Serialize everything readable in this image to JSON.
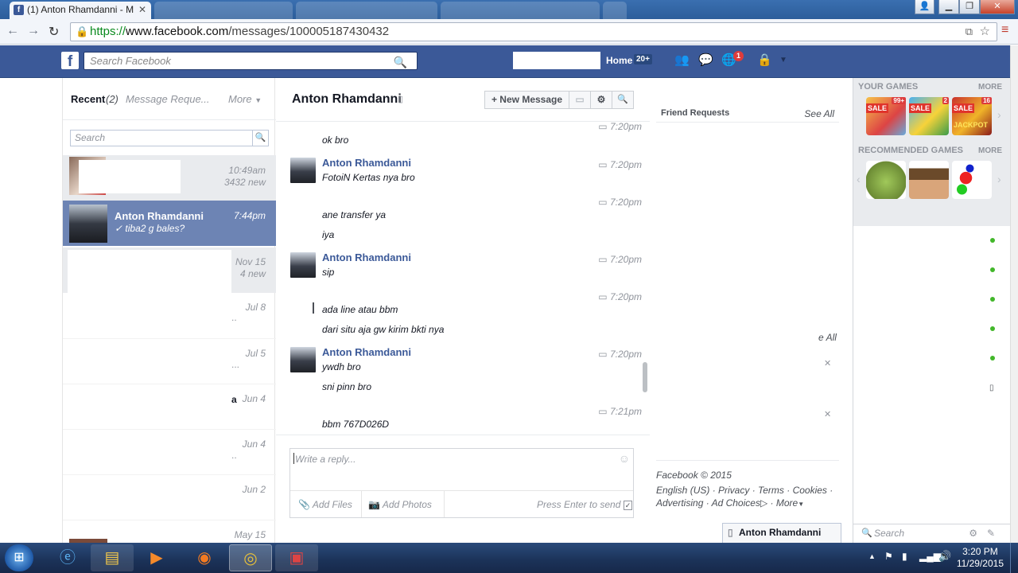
{
  "browser": {
    "active_tab_title": "(1) Anton Rhamdanni - M",
    "url_scheme": "https://",
    "url_domain": "www.facebook.com",
    "url_path": "/messages/100005187430432"
  },
  "fb_header": {
    "search_placeholder": "Search Facebook",
    "home_label": "Home",
    "home_count": "20+",
    "notification_count": "1"
  },
  "inbox": {
    "tab_recent": "Recent",
    "recent_count": "(2)",
    "tab_requests": "Message Reque...",
    "more_label": "More",
    "search_placeholder": "Search",
    "threads": [
      {
        "name": "",
        "snippet": "",
        "time": "10:49am",
        "new_count": "3432 new"
      },
      {
        "name": "Anton Rhamdanni",
        "snippet": "✓ tiba2 g bales?",
        "time": "7:44pm",
        "new_count": ""
      },
      {
        "name": "",
        "snippet": "",
        "time": "Nov 15",
        "new_count": "4 new"
      },
      {
        "name": "",
        "snippet": "",
        "time": "Jul 8",
        "new_count": ""
      },
      {
        "name": "",
        "snippet": "",
        "time": "Jul 5",
        "new_count": ""
      },
      {
        "name": "",
        "snippet": "",
        "time": "Jun 4",
        "new_count": ""
      },
      {
        "name": "",
        "snippet": "",
        "time": "Jun 4",
        "new_count": ""
      },
      {
        "name": "",
        "snippet": "",
        "time": "Jun 2",
        "new_count": ""
      },
      {
        "name": "",
        "snippet": "",
        "time": "May 15",
        "new_count": ""
      }
    ]
  },
  "conversation": {
    "title": "Anton Rhamdanni",
    "new_message_label": "+ New Message",
    "messages": [
      {
        "sender": "",
        "text": "ok bro",
        "time": "7:20pm"
      },
      {
        "sender": "Anton Rhamdanni",
        "text": "FotoiN Kertas nya bro",
        "time": "7:20pm"
      },
      {
        "sender": "",
        "text": "ane transfer ya",
        "time": "7:20pm"
      },
      {
        "sender": "",
        "text": "iya",
        "time": ""
      },
      {
        "sender": "Anton Rhamdanni",
        "text": "sip",
        "time": "7:20pm"
      },
      {
        "sender": "",
        "text": "ada line atau bbm",
        "time": "7:20pm"
      },
      {
        "sender": "",
        "text": "dari situ aja gw kirim bkti nya",
        "time": ""
      },
      {
        "sender": "Anton Rhamdanni",
        "text": "ywdh bro",
        "time": "7:20pm"
      },
      {
        "sender": "",
        "text": "sni pinn bro",
        "time": ""
      },
      {
        "sender": "",
        "text": "bbm 767D026D",
        "time": "7:21pm"
      }
    ],
    "reply_placeholder": "Write a reply...",
    "add_files_label": "Add Files",
    "add_photos_label": "Add Photos",
    "press_enter_label": "Press Enter to send"
  },
  "right_column": {
    "friend_requests_label": "Friend Requests",
    "see_all_label": "See All",
    "see_all_partial": "e All",
    "footer_copyright": "Facebook © 2015",
    "footer_links_1": "English (US) · Privacy · Terms · Cookies ·",
    "footer_links_2": "Advertising · Ad Choices",
    "footer_more": "More",
    "chat_tab_name": "Anton Rhamdanni"
  },
  "games": {
    "your_games_label": "YOUR GAMES",
    "recommended_label": "RECOMMENDED GAMES",
    "more_label": "MORE",
    "sale_label": "SALE",
    "badges": [
      "99+",
      "2",
      "16"
    ],
    "jackpot_label": "JACKPOT"
  },
  "chat_sidebar": {
    "search_placeholder": "Search"
  },
  "taskbar": {
    "time": "3:20 PM",
    "date": "11/29/2015"
  }
}
